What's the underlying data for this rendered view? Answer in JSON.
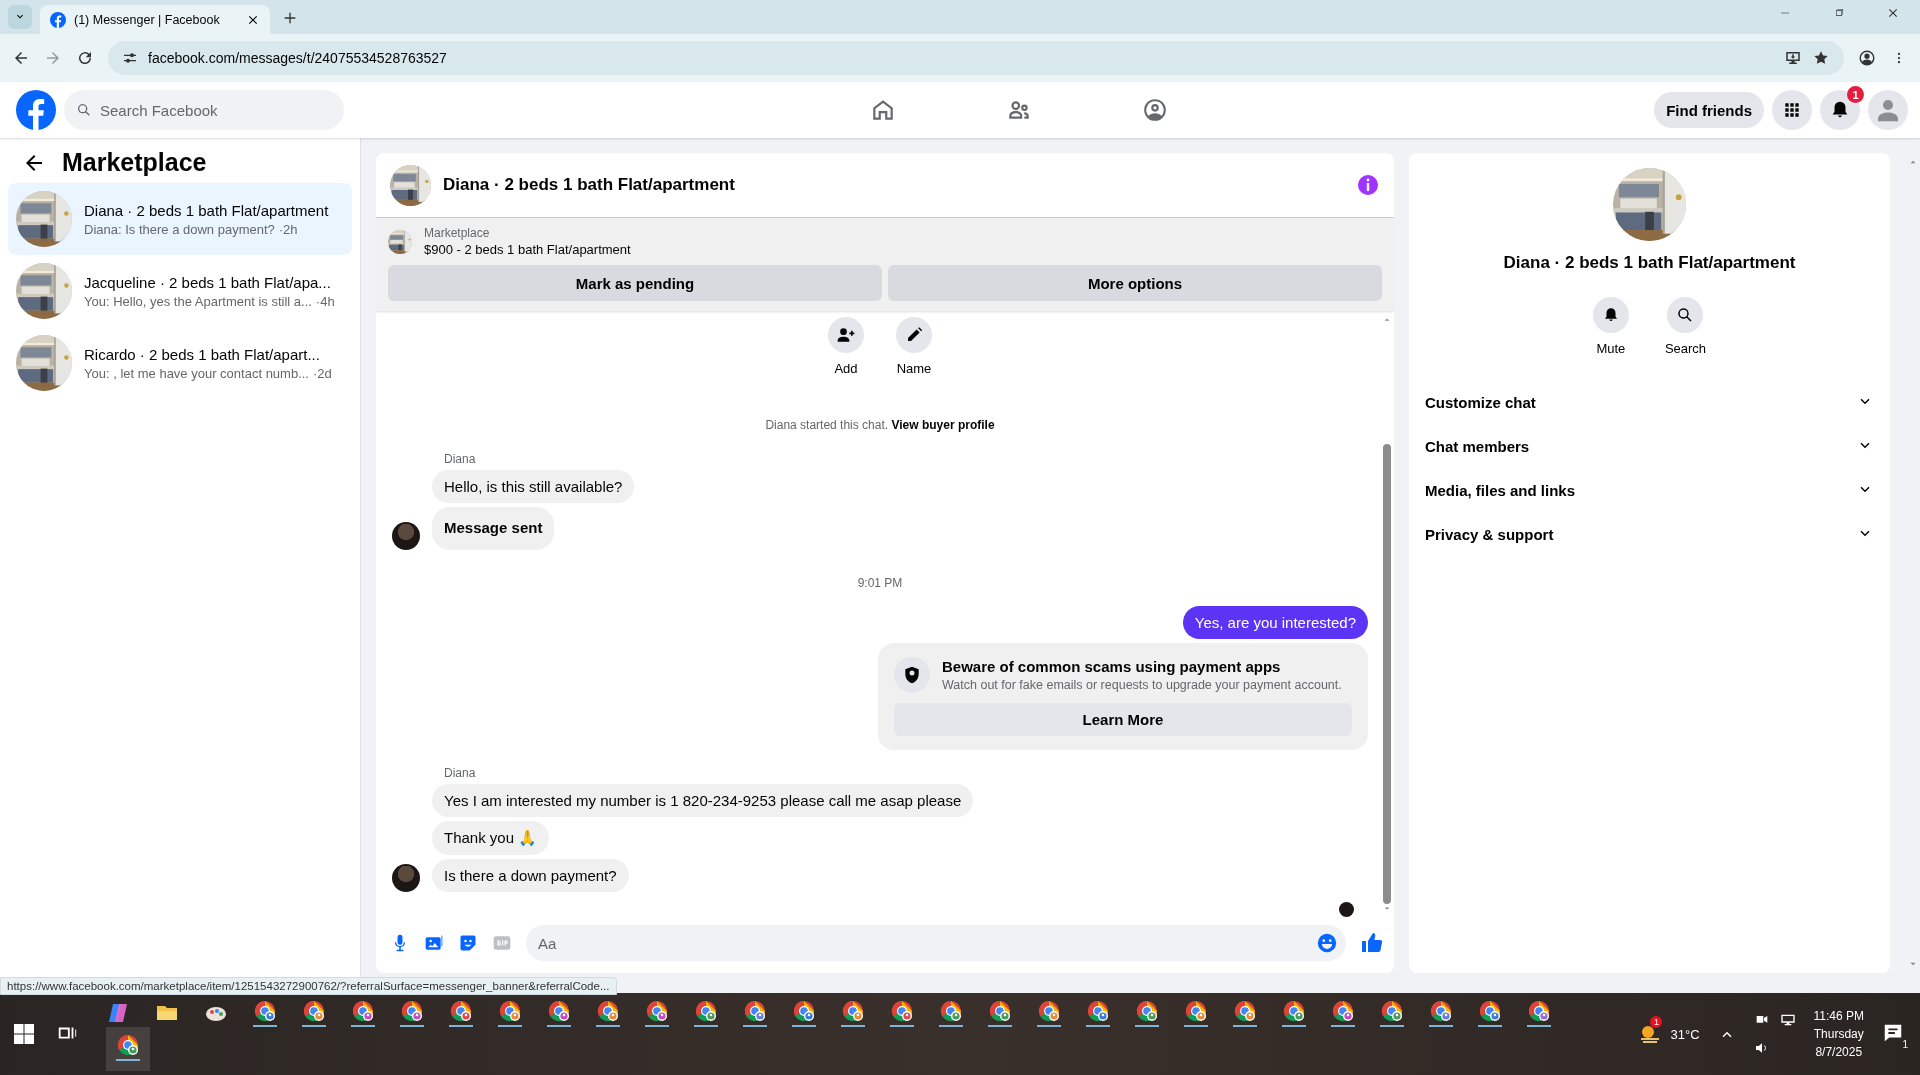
{
  "browser": {
    "tab_title": "(1) Messenger | Facebook",
    "url": "facebook.com/messages/t/24075534528763527",
    "status_url": "https://www.facebook.com/marketplace/item/1251543272900762/?referralSurface=messenger_banner&referralCode..."
  },
  "header": {
    "search": {
      "placeholder": "Search Facebook"
    },
    "find_friends": "Find friends",
    "notification_count": "1"
  },
  "sidebar": {
    "title": "Marketplace",
    "conversations": [
      {
        "title": "Diana · 2 beds 1 bath Flat/apartment",
        "preview": "Diana: Is there a down payment?",
        "time": "·2h",
        "selected": true
      },
      {
        "title": "Jacqueline · 2 beds 1 bath Flat/apa...",
        "preview": "You: Hello, yes the Apartment is still a...",
        "time": "·4h",
        "selected": false
      },
      {
        "title": "Ricardo · 2 beds 1 bath Flat/apart...",
        "preview": "You: , let me have your contact numb...",
        "time": "·2d",
        "selected": false
      }
    ]
  },
  "chat": {
    "title": "Diana · 2 beds 1 bath Flat/apartment",
    "listing": {
      "source": "Marketplace",
      "name": "$900 - 2 beds 1 bath Flat/apartment",
      "buttons": [
        "Mark as pending",
        "More options"
      ]
    },
    "actions": [
      "Add",
      "Name"
    ],
    "started": {
      "text": "Diana started this chat.",
      "link": "View buyer profile"
    },
    "messages": [
      {
        "kind": "sender",
        "text": "Diana"
      },
      {
        "kind": "incoming",
        "text": "Hello, is this still available?",
        "avatar": false,
        "emphasis": false
      },
      {
        "kind": "incoming",
        "text": "Message sent",
        "avatar": true,
        "emphasis": true
      },
      {
        "kind": "time",
        "text": "9:01 PM"
      },
      {
        "kind": "outgoing",
        "text": "Yes, are you interested?"
      },
      {
        "kind": "warning",
        "title": "Beware of common scams using payment apps",
        "body": "Watch out for fake emails or requests to upgrade your payment account.",
        "button": "Learn More"
      },
      {
        "kind": "sender",
        "text": "Diana"
      },
      {
        "kind": "incoming",
        "text": "Yes I am interested my number is 1 820-234-9253 please call me asap please",
        "avatar": false,
        "emphasis": false
      },
      {
        "kind": "incoming",
        "text": "Thank you 🙏",
        "avatar": false,
        "emphasis": false
      },
      {
        "kind": "incoming",
        "text": "Is there a down payment?",
        "avatar": true,
        "emphasis": false
      }
    ],
    "composer": {
      "placeholder": "Aa"
    }
  },
  "details": {
    "title": "Diana · 2 beds 1 bath Flat/apartment",
    "actions": [
      "Mute",
      "Search"
    ],
    "sections": [
      {
        "label": "Customize chat",
        "expanded": false
      },
      {
        "label": "Chat members",
        "expanded": false
      },
      {
        "label": "Media, files and links",
        "expanded": false
      },
      {
        "label": "Privacy & support",
        "expanded": false
      }
    ]
  },
  "taskbar": {
    "weather": {
      "temperature": "31°C",
      "badge": "1"
    },
    "time": "11:46 PM",
    "day": "Thursday",
    "date": "8/7/2025",
    "notification_count": "1"
  }
}
